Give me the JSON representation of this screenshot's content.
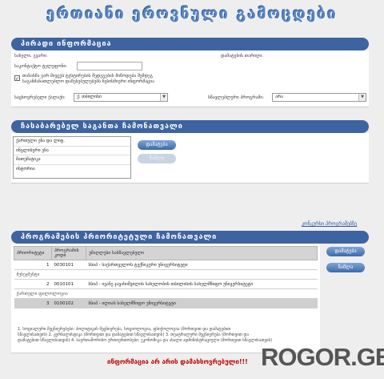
{
  "page": {
    "title": "ერთიანი ეროვნული გამოცდები"
  },
  "personal": {
    "header": "პირადი ინფორმაცია",
    "name_label": "სახელი, გვარი:",
    "exam_place_label": "დამატების თარიღი:",
    "phone_label": "საკონტაქტო ტელეფონი:",
    "phone_value": "",
    "consent_line1": "თანახმა ვარ მიეცეს ტესტირების შედეგების მიწოდება შემდეგ",
    "consent_line2": "საგანმანათლებლო დაწესებულებებს ნებისმიერი ინფორმაცია",
    "consent_checked": "✓",
    "region_label": "საცხოვრებელი ქალაქი:",
    "region_value": "ქ. თბილისი",
    "type_label": "სწავლებლური პროგრამი:",
    "type_value": "არა"
  },
  "subjects": {
    "header": "ჩასაბარებელ საგანთა ჩამონათვალი",
    "items": [
      "ქართული ენა და ლიტ.",
      "ინგლისური ენა",
      "მათემატიკა",
      "ისტორია"
    ],
    "add_button": "დამატება",
    "remove_button": "წაშლა"
  },
  "priority_link": "კონკურსი პროგრამებზე",
  "programs": {
    "header": "პროგრამების პრიორიტეტული ჩამონათვალი",
    "columns": [
      "პრიორიტეტი",
      "პროგრამის კოდი",
      "უმაღლესი სასწავლებელი"
    ],
    "rows": [
      {
        "kind": "row",
        "priority": "1",
        "code": "0030101",
        "name": "სსიპ - საქართველოს ტექნიკური უნივერსიტეტი"
      },
      {
        "kind": "group",
        "label": "მენეჯმენტი"
      },
      {
        "kind": "row",
        "priority": "2",
        "code": "0010101",
        "name": "სსიპ - ივანე ჯავახიშვილის სახელობის თბილისის სახელმწიფო უნივერსიტეტი"
      },
      {
        "kind": "group",
        "label": "ქართული ფილოლოგია"
      },
      {
        "kind": "row",
        "priority": "3",
        "code": "0100102",
        "name": "სსიპ - ილიას სახელმწიფო უნივერსიტეტი",
        "selected": true
      }
    ],
    "add_button": "დამატება",
    "remove_button": "წაშლა",
    "note_line1": "1. სოციალური მეცნიერებები: პოლიტიკის მეცნიერება, სოციოლოგია, ფსიქოლოგია (მორთვით და დამატებით",
    "note_line2": "სწავლისათვის) 2. ჟურნალისტიკა (მორთვით და დამატებით სწავლისათვის) 3. თეატრალური მეცნიერება (მორთვით და",
    "note_line3": "დამატებით სწავლისათვის) 4. საერთაშორისო ურთიერთობები: ეკონომიკა და ახალი ადმინისტრაციული (მორთვით სწავლისათვის)"
  },
  "notice": "ინფორმაცია არ არის დამახსოვრებული!!!",
  "watermark": "ROGOR.GE"
}
